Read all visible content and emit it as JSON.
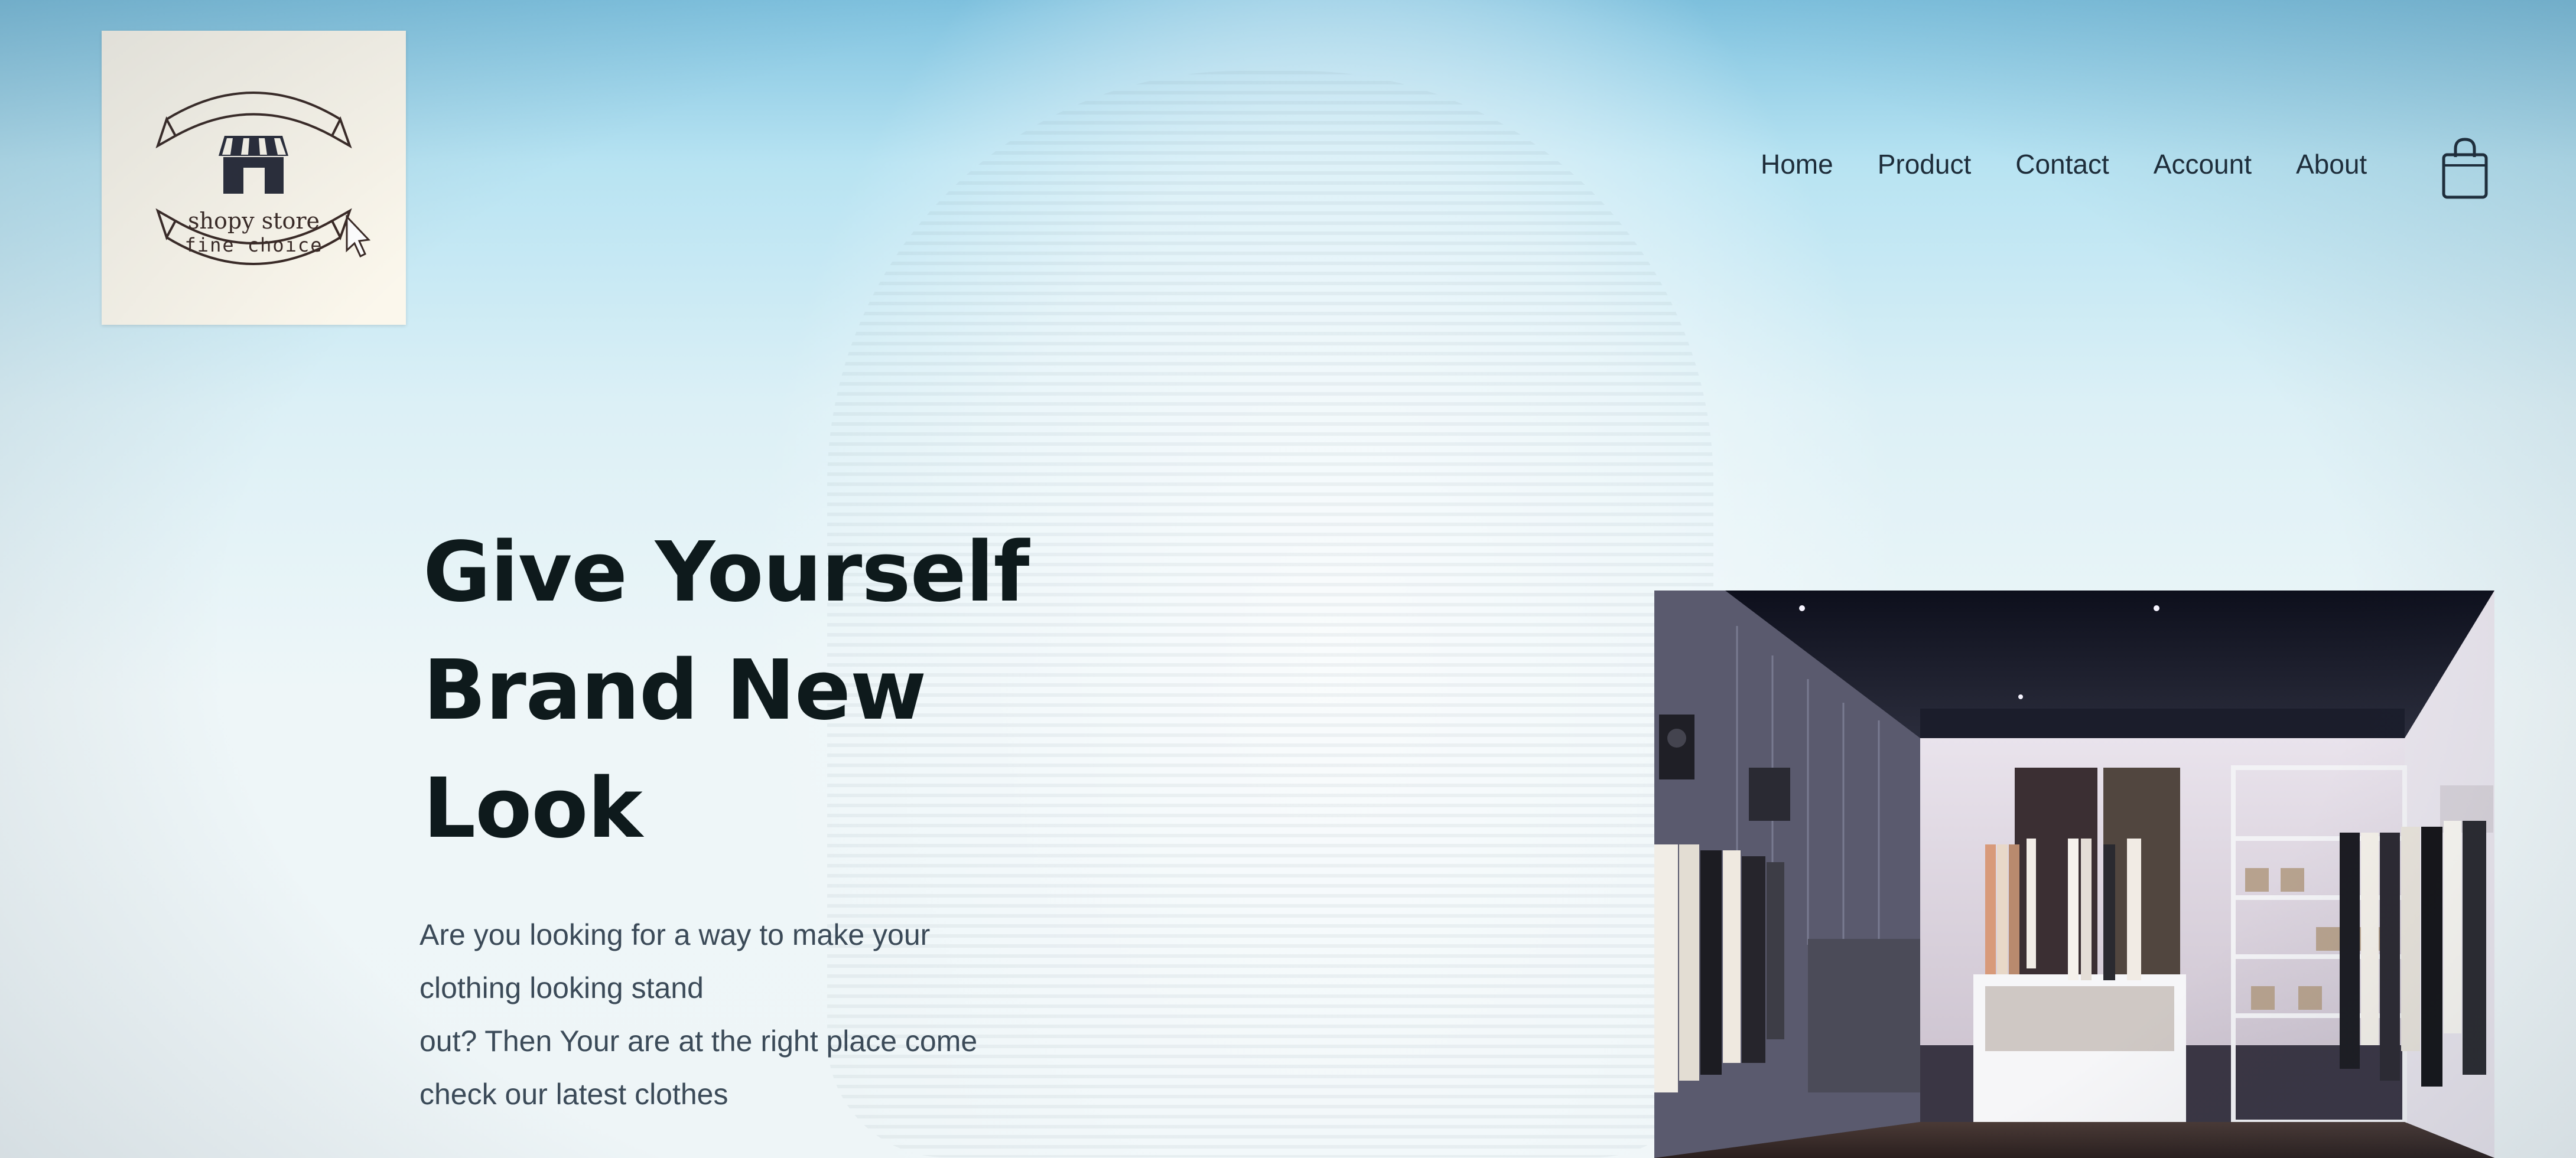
{
  "logo": {
    "name": "shopy store",
    "tagline": "fine choice"
  },
  "nav": {
    "items": [
      {
        "label": "Home"
      },
      {
        "label": "Product"
      },
      {
        "label": "Contact"
      },
      {
        "label": "Account"
      },
      {
        "label": "About"
      }
    ],
    "cart_icon": "shopping-bag-icon"
  },
  "hero": {
    "title_lines": [
      "Give Yourself",
      "Brand New",
      "Look"
    ],
    "description_lines": [
      "Are you looking for a way to make your",
      "clothing looking stand",
      "out? Then Your are at the right place come",
      "check our latest clothes"
    ],
    "image": "clothing-store-interior-photo"
  },
  "colors": {
    "nav_text": "#1e2d3a",
    "title_text": "#0e1a1c",
    "body_text": "#3b4a58",
    "logo_bg": "#fbf7ec"
  }
}
